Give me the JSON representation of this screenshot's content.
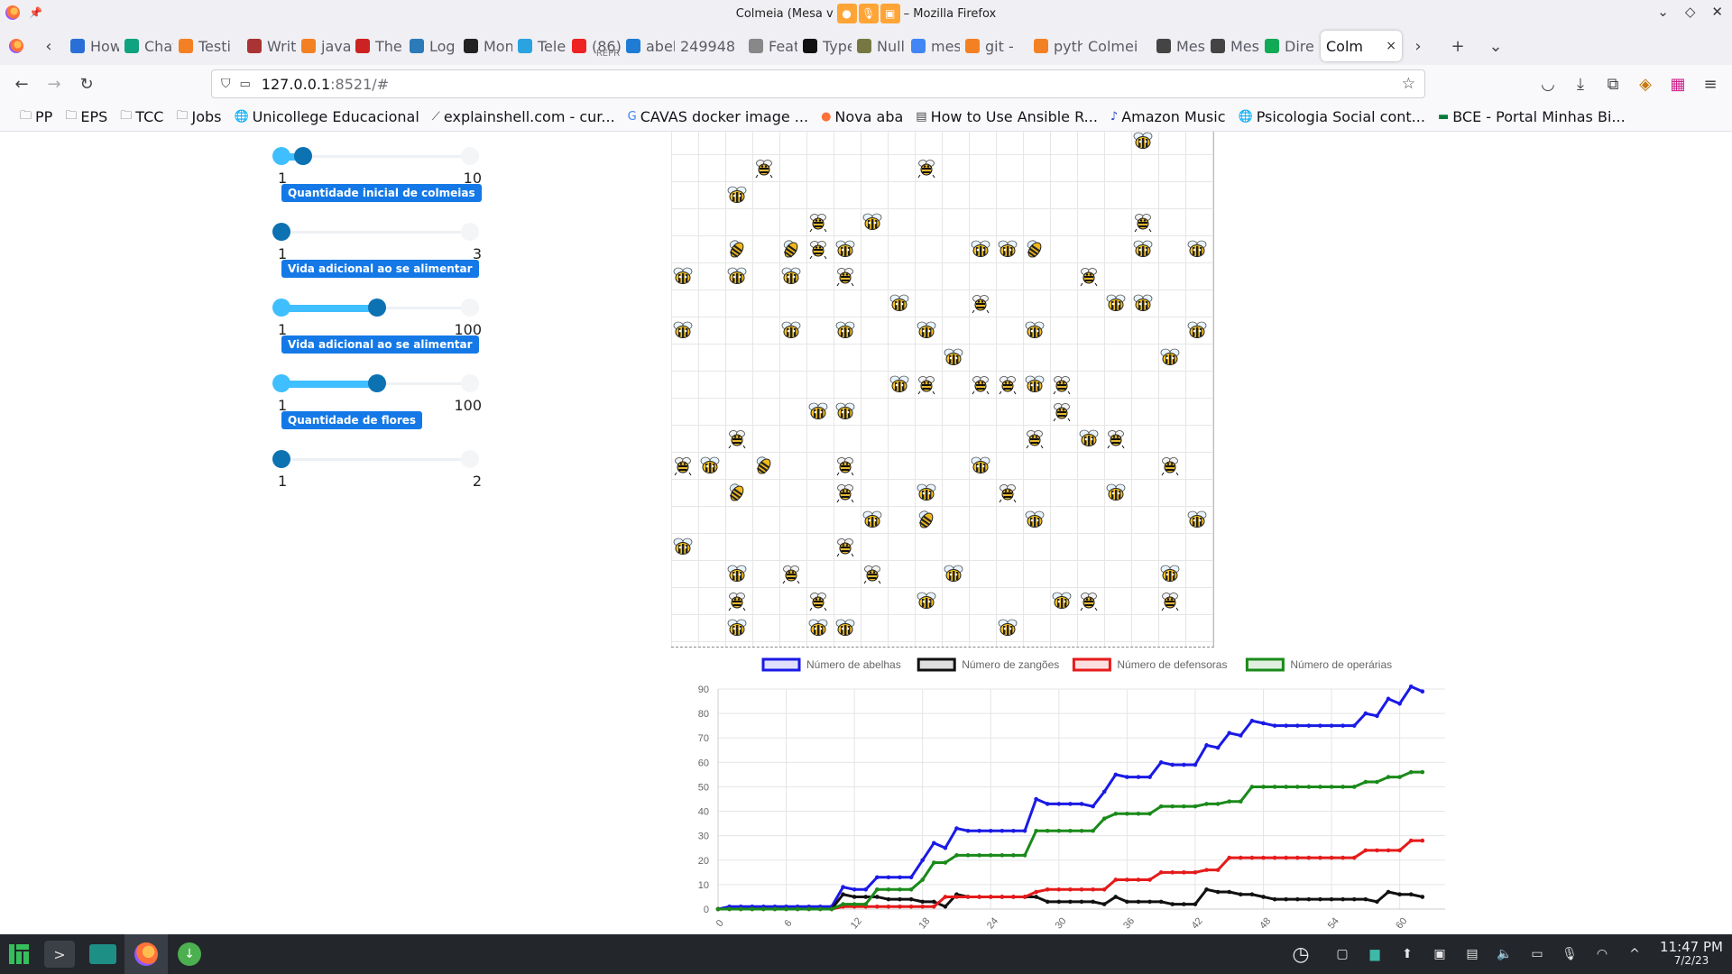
{
  "window": {
    "title_prefix": "Colmeia (Mesa v",
    "title_suffix": "– Mozilla Firefox"
  },
  "tabs": [
    {
      "label": "How",
      "icon": "global-icon",
      "color": "#2a6fd6"
    },
    {
      "label": "Chat",
      "icon": "chatgpt-icon",
      "color": "#10a37f"
    },
    {
      "label": "Testi",
      "icon": "stackoverflow-icon",
      "color": "#f48024"
    },
    {
      "label": "Writ",
      "icon": "book-icon",
      "color": "#a33"
    },
    {
      "label": "java",
      "icon": "stackoverflow-icon",
      "color": "#f48024"
    },
    {
      "label": "The",
      "icon": "blog-icon",
      "color": "#c22"
    },
    {
      "label": "Log",
      "icon": "logs-icon",
      "color": "#2b7bb9"
    },
    {
      "label": "Mon",
      "icon": "mt-icon",
      "color": "#222"
    },
    {
      "label": "Tele",
      "icon": "telegram-icon",
      "color": "#2aa3e0"
    },
    {
      "label": "(86)",
      "sub": "REPR",
      "icon": "youtube-icon",
      "color": "#e22"
    },
    {
      "label": "abel",
      "icon": "vscode-icon",
      "color": "#1f7bd4"
    },
    {
      "label": "249948",
      "icon": "",
      "color": ""
    },
    {
      "label": "Feat",
      "icon": "github-icon",
      "color": "#888"
    },
    {
      "label": "Type",
      "icon": "typescript-icon",
      "color": "#111"
    },
    {
      "label": "Null",
      "icon": "avatar-icon",
      "color": "#774"
    },
    {
      "label": "mes",
      "icon": "google-icon",
      "color": "#4285f4"
    },
    {
      "label": "git -",
      "icon": "stackoverflow-icon",
      "color": "#f48024"
    },
    {
      "label": "pyth",
      "icon": "stackoverflow-icon",
      "color": "#f48024"
    },
    {
      "label": "Colmei",
      "icon": "",
      "color": ""
    },
    {
      "label": "Mes",
      "icon": "doc-icon",
      "color": "#444"
    },
    {
      "label": "Mes",
      "icon": "doc-icon",
      "color": "#444"
    },
    {
      "label": "Dire",
      "icon": "flag-icon",
      "color": "#1a5"
    }
  ],
  "active_tab": {
    "label": "Colm",
    "close": "×"
  },
  "url": {
    "host": "127.0.0.1",
    "rest": ":8521/#"
  },
  "bookmarks": [
    {
      "label": "PP",
      "icon": "folder-icon"
    },
    {
      "label": "EPS",
      "icon": "folder-icon"
    },
    {
      "label": "TCC",
      "icon": "folder-icon"
    },
    {
      "label": "Jobs",
      "icon": "folder-icon"
    },
    {
      "label": "Unicollege Educacional",
      "icon": "globe-icon"
    },
    {
      "label": "explainshell.com - cur...",
      "icon": "shell-icon"
    },
    {
      "label": "CAVAS docker image ...",
      "icon": "google-icon"
    },
    {
      "label": "Nova aba",
      "icon": "firefox-icon"
    },
    {
      "label": "How to Use Ansible R...",
      "icon": "chart-icon"
    },
    {
      "label": "Amazon Music",
      "icon": "music-icon"
    },
    {
      "label": "Psicologia Social cont...",
      "icon": "globe-icon"
    },
    {
      "label": "BCE - Portal Minhas Bi...",
      "icon": "bank-icon"
    }
  ],
  "sliders": [
    {
      "min": "1",
      "max": "10",
      "value": 2,
      "range": [
        1,
        10
      ],
      "label": null
    },
    {
      "min": "1",
      "max": "3",
      "value": 1,
      "range": [
        1,
        3
      ],
      "label": "Quantidade inicial de colmeias"
    },
    {
      "min": "1",
      "max": "100",
      "value": 50,
      "range": [
        1,
        100
      ],
      "label": "Vida adicional ao se alimentar"
    },
    {
      "min": "1",
      "max": "100",
      "value": 50,
      "range": [
        1,
        100
      ],
      "label": "Vida adicional ao se alimentar"
    },
    {
      "min": "1",
      "max": "2",
      "value": 1,
      "range": [
        1,
        2
      ],
      "label": "Quantidade de flores"
    }
  ],
  "grid": {
    "cols": 20,
    "rows": 19,
    "agents": [
      {
        "c": 17,
        "r": 0,
        "k": "w"
      },
      {
        "c": 3,
        "r": 1,
        "k": "d"
      },
      {
        "c": 9,
        "r": 1,
        "k": "d"
      },
      {
        "c": 2,
        "r": 2,
        "k": "w"
      },
      {
        "c": 5,
        "r": 3,
        "k": "d"
      },
      {
        "c": 7,
        "r": 3,
        "k": "w"
      },
      {
        "c": 17,
        "r": 3,
        "k": "d"
      },
      {
        "c": 2,
        "r": 4,
        "k": "q"
      },
      {
        "c": 4,
        "r": 4,
        "k": "q"
      },
      {
        "c": 5,
        "r": 4,
        "k": "d"
      },
      {
        "c": 6,
        "r": 4,
        "k": "w"
      },
      {
        "c": 11,
        "r": 4,
        "k": "w"
      },
      {
        "c": 12,
        "r": 4,
        "k": "w"
      },
      {
        "c": 13,
        "r": 4,
        "k": "q"
      },
      {
        "c": 17,
        "r": 4,
        "k": "w"
      },
      {
        "c": 19,
        "r": 4,
        "k": "w"
      },
      {
        "c": 0,
        "r": 5,
        "k": "w"
      },
      {
        "c": 2,
        "r": 5,
        "k": "w"
      },
      {
        "c": 4,
        "r": 5,
        "k": "w"
      },
      {
        "c": 6,
        "r": 5,
        "k": "d"
      },
      {
        "c": 15,
        "r": 5,
        "k": "d"
      },
      {
        "c": 8,
        "r": 6,
        "k": "w"
      },
      {
        "c": 11,
        "r": 6,
        "k": "d"
      },
      {
        "c": 16,
        "r": 6,
        "k": "w"
      },
      {
        "c": 17,
        "r": 6,
        "k": "w"
      },
      {
        "c": 0,
        "r": 7,
        "k": "w"
      },
      {
        "c": 4,
        "r": 7,
        "k": "w"
      },
      {
        "c": 6,
        "r": 7,
        "k": "w"
      },
      {
        "c": 9,
        "r": 7,
        "k": "w"
      },
      {
        "c": 13,
        "r": 7,
        "k": "w"
      },
      {
        "c": 19,
        "r": 7,
        "k": "w"
      },
      {
        "c": 10,
        "r": 8,
        "k": "w"
      },
      {
        "c": 18,
        "r": 8,
        "k": "w"
      },
      {
        "c": 8,
        "r": 9,
        "k": "w"
      },
      {
        "c": 9,
        "r": 9,
        "k": "d"
      },
      {
        "c": 11,
        "r": 9,
        "k": "d"
      },
      {
        "c": 12,
        "r": 9,
        "k": "d"
      },
      {
        "c": 13,
        "r": 9,
        "k": "w"
      },
      {
        "c": 14,
        "r": 9,
        "k": "d"
      },
      {
        "c": 5,
        "r": 10,
        "k": "w"
      },
      {
        "c": 6,
        "r": 10,
        "k": "w"
      },
      {
        "c": 14,
        "r": 10,
        "k": "d"
      },
      {
        "c": 2,
        "r": 11,
        "k": "d"
      },
      {
        "c": 13,
        "r": 11,
        "k": "d"
      },
      {
        "c": 15,
        "r": 11,
        "k": "w"
      },
      {
        "c": 16,
        "r": 11,
        "k": "d"
      },
      {
        "c": 0,
        "r": 12,
        "k": "d"
      },
      {
        "c": 1,
        "r": 12,
        "k": "w"
      },
      {
        "c": 3,
        "r": 12,
        "k": "q"
      },
      {
        "c": 6,
        "r": 12,
        "k": "d"
      },
      {
        "c": 11,
        "r": 12,
        "k": "w"
      },
      {
        "c": 18,
        "r": 12,
        "k": "d"
      },
      {
        "c": 2,
        "r": 13,
        "k": "q"
      },
      {
        "c": 6,
        "r": 13,
        "k": "d"
      },
      {
        "c": 9,
        "r": 13,
        "k": "w"
      },
      {
        "c": 12,
        "r": 13,
        "k": "d"
      },
      {
        "c": 16,
        "r": 13,
        "k": "w"
      },
      {
        "c": 7,
        "r": 14,
        "k": "w"
      },
      {
        "c": 9,
        "r": 14,
        "k": "q"
      },
      {
        "c": 13,
        "r": 14,
        "k": "w"
      },
      {
        "c": 19,
        "r": 14,
        "k": "w"
      },
      {
        "c": 0,
        "r": 15,
        "k": "w"
      },
      {
        "c": 6,
        "r": 15,
        "k": "d"
      },
      {
        "c": 2,
        "r": 16,
        "k": "w"
      },
      {
        "c": 4,
        "r": 16,
        "k": "d"
      },
      {
        "c": 7,
        "r": 16,
        "k": "d"
      },
      {
        "c": 10,
        "r": 16,
        "k": "w"
      },
      {
        "c": 18,
        "r": 16,
        "k": "w"
      },
      {
        "c": 2,
        "r": 17,
        "k": "d"
      },
      {
        "c": 5,
        "r": 17,
        "k": "d"
      },
      {
        "c": 9,
        "r": 17,
        "k": "w"
      },
      {
        "c": 14,
        "r": 17,
        "k": "w"
      },
      {
        "c": 15,
        "r": 17,
        "k": "d"
      },
      {
        "c": 18,
        "r": 17,
        "k": "d"
      },
      {
        "c": 2,
        "r": 18,
        "k": "w"
      },
      {
        "c": 5,
        "r": 18,
        "k": "w"
      },
      {
        "c": 6,
        "r": 18,
        "k": "w"
      },
      {
        "c": 12,
        "r": 18,
        "k": "w"
      }
    ]
  },
  "chart_data": {
    "type": "line",
    "legend_position": "top",
    "grid": true,
    "ylim": [
      0,
      90
    ],
    "y_ticks": [
      0,
      10,
      20,
      30,
      40,
      50,
      60,
      70,
      80,
      90
    ],
    "x_ticks": [
      0,
      6,
      12,
      18,
      24,
      30,
      36,
      42,
      48,
      54,
      60
    ],
    "x_range": [
      0,
      64
    ],
    "series": [
      {
        "name": "Número de abelhas",
        "color": "#1a1ae6",
        "values": [
          0,
          1,
          1,
          1,
          1,
          1,
          1,
          1,
          1,
          1,
          1,
          9,
          8,
          8,
          13,
          13,
          13,
          13,
          20,
          27,
          25,
          33,
          32,
          32,
          32,
          32,
          32,
          32,
          45,
          43,
          43,
          43,
          43,
          42,
          48,
          55,
          54,
          54,
          54,
          60,
          59,
          59,
          59,
          67,
          66,
          72,
          71,
          77,
          76,
          75,
          75,
          75,
          75,
          75,
          75,
          75,
          75,
          80,
          79,
          86,
          84,
          91,
          89
        ]
      },
      {
        "name": "Número de zangões",
        "color": "#111111",
        "values": [
          0,
          0,
          0,
          0,
          0,
          0,
          0,
          0,
          0,
          0,
          0,
          6,
          5,
          5,
          5,
          4,
          4,
          4,
          3,
          3,
          1,
          6,
          5,
          5,
          5,
          5,
          5,
          5,
          5,
          3,
          3,
          3,
          3,
          3,
          2,
          5,
          3,
          3,
          3,
          3,
          2,
          2,
          2,
          8,
          7,
          7,
          6,
          6,
          5,
          4,
          4,
          4,
          4,
          4,
          4,
          4,
          4,
          4,
          3,
          7,
          6,
          6,
          5
        ]
      },
      {
        "name": "Número de defensoras",
        "color": "#e61a1a",
        "values": [
          0,
          0,
          0,
          0,
          0,
          0,
          0,
          0,
          0,
          0,
          0,
          1,
          1,
          1,
          1,
          1,
          1,
          1,
          1,
          1,
          5,
          5,
          5,
          5,
          5,
          5,
          5,
          5,
          7,
          8,
          8,
          8,
          8,
          8,
          8,
          12,
          12,
          12,
          12,
          15,
          15,
          15,
          15,
          16,
          16,
          21,
          21,
          21,
          21,
          21,
          21,
          21,
          21,
          21,
          21,
          21,
          21,
          24,
          24,
          24,
          24,
          28,
          28
        ]
      },
      {
        "name": "Número de operárias",
        "color": "#1a8a1a",
        "values": [
          0,
          0,
          0,
          0,
          0,
          0,
          0,
          0,
          0,
          0,
          0,
          2,
          2,
          2,
          8,
          8,
          8,
          8,
          12,
          19,
          19,
          22,
          22,
          22,
          22,
          22,
          22,
          22,
          32,
          32,
          32,
          32,
          32,
          32,
          37,
          39,
          39,
          39,
          39,
          42,
          42,
          42,
          42,
          43,
          43,
          44,
          44,
          50,
          50,
          50,
          50,
          50,
          50,
          50,
          50,
          50,
          50,
          52,
          52,
          54,
          54,
          56,
          56
        ]
      }
    ]
  },
  "taskbar": {
    "apps": [
      {
        "name": "manjaro-menu-icon"
      },
      {
        "name": "terminal-icon"
      },
      {
        "name": "file-manager-icon"
      },
      {
        "name": "firefox-icon"
      },
      {
        "name": "download-icon"
      }
    ],
    "tray_icons": [
      "clock-app-icon",
      "screen-icon",
      "green-app-icon",
      "vpn-icon",
      "devices-icon",
      "clipboard-icon",
      "volume-icon",
      "battery-icon",
      "microphone-icon",
      "wifi-icon",
      "tray-expand-icon"
    ],
    "time": "11:47 PM",
    "date": "7/2/23"
  }
}
